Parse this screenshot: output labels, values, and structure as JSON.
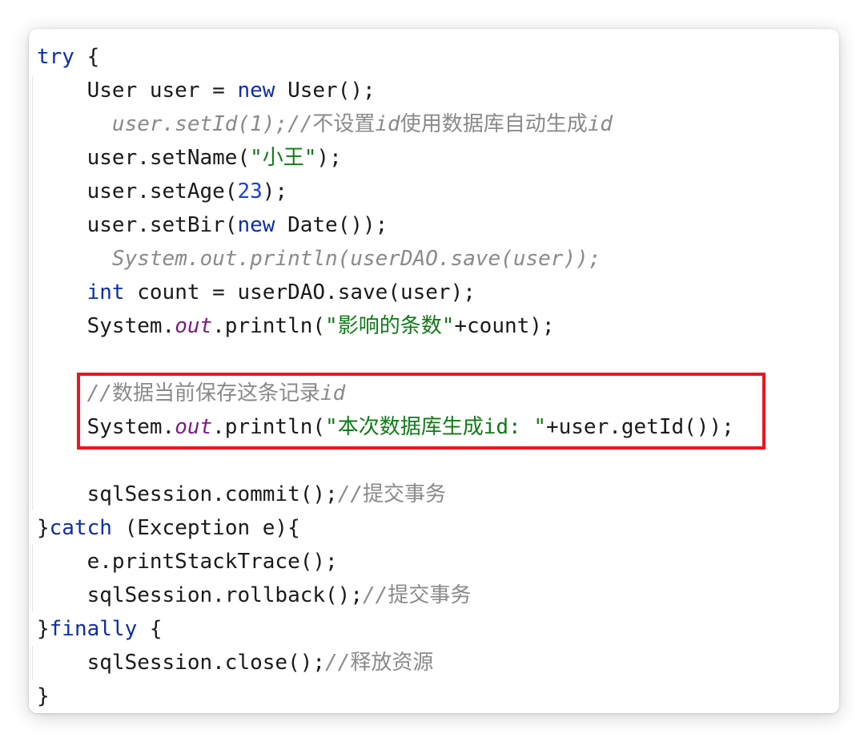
{
  "code": {
    "line1_kw": "try",
    "line1_rest": " {",
    "line2_a": "    User user = ",
    "line2_kw": "new",
    "line2_b": " User();",
    "line3_indent": "      ",
    "line3_a": "user.setId(1);//",
    "line3_b": "不设置",
    "line3_c": "id",
    "line3_d": "使用数据库自动生成",
    "line3_e": "id",
    "line4_a": "    user.setName(",
    "line4_str": "\"小王\"",
    "line4_b": ");",
    "line5_a": "    user.setAge(",
    "line5_num": "23",
    "line5_b": ");",
    "line6_a": "    user.setBir(",
    "line6_kw": "new",
    "line6_b": " Date());",
    "line7_indent": "      ",
    "line7_cmt": "System.out.println(userDAO.save(user));",
    "line8_indent": "    ",
    "line8_kw": "int",
    "line8_b": " count = userDAO.save(user);",
    "line9_a": "    System.",
    "line9_field": "out",
    "line9_b": ".println(",
    "line9_str": "\"影响的条数\"",
    "line9_c": "+count);",
    "line11_indent": "    ",
    "line11_a": "//",
    "line11_b": "数据当前保存这条记录",
    "line11_c": "id",
    "line12_a": "    System.",
    "line12_field": "out",
    "line12_b": ".println(",
    "line12_str": "\"本次数据库生成id: \"",
    "line12_c": "+user.getId());",
    "line14_a": "    sqlSession.commit();",
    "line14_cmt": "//",
    "line14_cjk": "提交事务",
    "line15_a": "}",
    "line15_kw": "catch",
    "line15_b": " (Exception e){",
    "line16_a": "    e.printStackTrace();",
    "line17_a": "    sqlSession.rollback();",
    "line17_cmt": "//",
    "line17_cjk": "提交事务",
    "line18_a": "}",
    "line18_kw": "finally",
    "line18_b": " {",
    "line19_a": "    sqlSession.close();",
    "line19_cmt": "//",
    "line19_cjk": "释放资源",
    "line20_a": "}"
  },
  "colors": {
    "keyword": "#0d2ea6",
    "string": "#127a18",
    "number": "#1a3fd9",
    "comment": "#8a8a8a",
    "static_field": "#7b1a86",
    "highlight_border": "#f0141e"
  }
}
